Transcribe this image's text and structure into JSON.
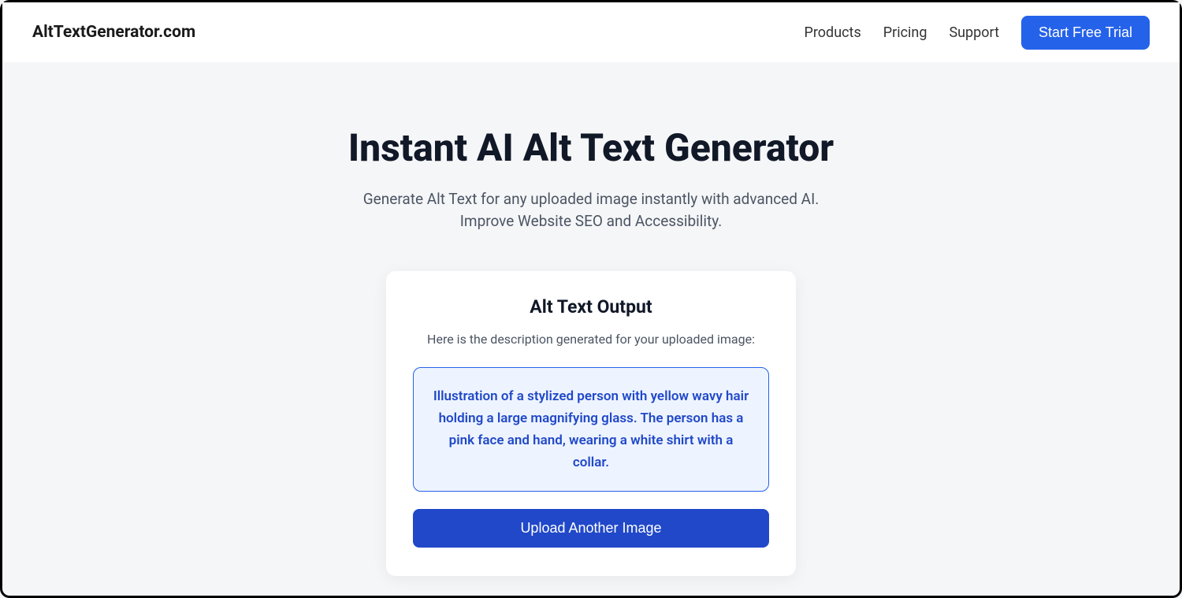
{
  "header": {
    "logo": "AltTextGenerator.com",
    "nav": {
      "products": "Products",
      "pricing": "Pricing",
      "support": "Support"
    },
    "cta": "Start Free Trial"
  },
  "hero": {
    "title": "Instant AI Alt Text Generator",
    "subtitle": "Generate Alt Text for any uploaded image instantly with advanced AI. Improve Website SEO and Accessibility."
  },
  "card": {
    "title": "Alt Text Output",
    "subtitle": "Here is the description generated for your uploaded image:",
    "output": "Illustration of a stylized person with yellow wavy hair holding a large magnifying glass. The person has a pink face and hand, wearing a white shirt with a collar.",
    "upload_button": "Upload Another Image"
  }
}
